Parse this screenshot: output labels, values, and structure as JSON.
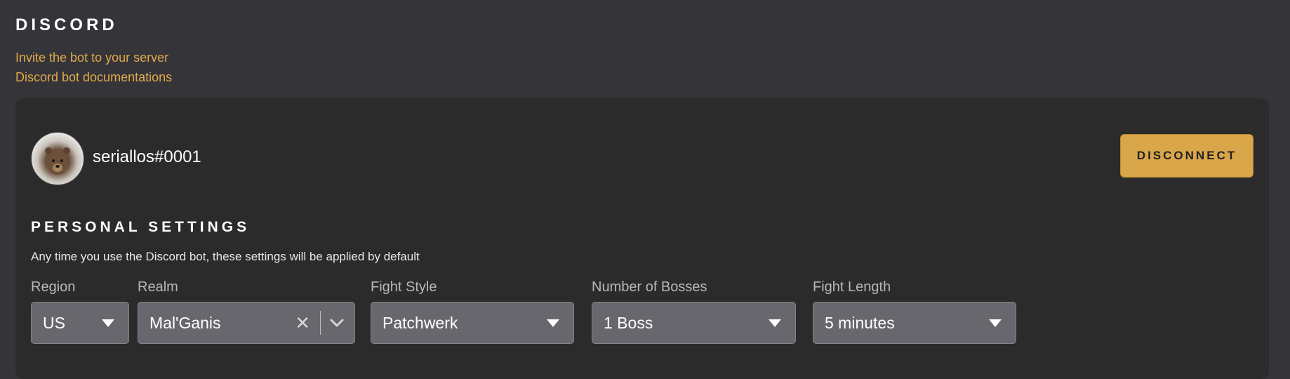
{
  "section": {
    "title": "DISCORD",
    "links": [
      "Invite the bot to your server",
      "Discord bot documentations"
    ]
  },
  "account": {
    "username": "seriallos#0001",
    "disconnect_label": "DISCONNECT"
  },
  "personal": {
    "title": "PERSONAL SETTINGS",
    "description": "Any time you use the Discord bot, these settings will be applied by default"
  },
  "fields": {
    "region": {
      "label": "Region",
      "value": "US"
    },
    "realm": {
      "label": "Realm",
      "value": "Mal'Ganis"
    },
    "fight_style": {
      "label": "Fight Style",
      "value": "Patchwerk"
    },
    "bosses": {
      "label": "Number of Bosses",
      "value": "1 Boss"
    },
    "fight_length": {
      "label": "Fight Length",
      "value": "5 minutes"
    }
  },
  "colors": {
    "background": "#353439",
    "card": "#2b2b2b",
    "accent": "#daa64a",
    "link": "#e0aa4a",
    "select": "#68676d"
  },
  "icons": [
    "bear-avatar",
    "caret-down-icon",
    "clear-icon",
    "chevron-down-icon"
  ]
}
